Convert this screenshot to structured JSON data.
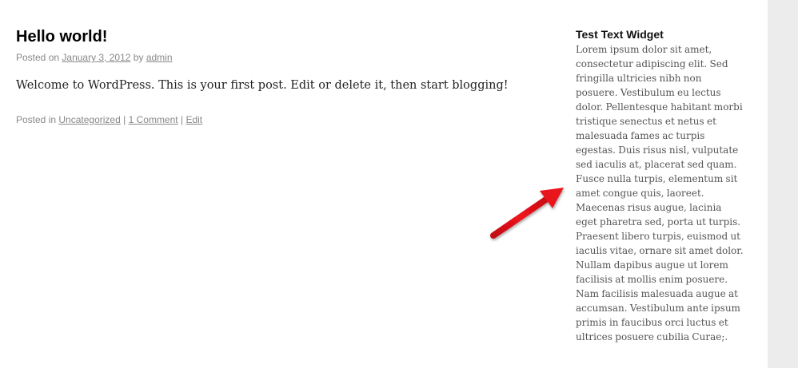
{
  "post": {
    "title": "Hello world!",
    "meta": {
      "posted_on": "Posted on",
      "date": "January 3, 2012",
      "by": "by",
      "author": "admin"
    },
    "content": "Welcome to WordPress. This is your first post. Edit or delete it, then start blogging!",
    "footer": {
      "posted_in": "Posted in",
      "category": "Uncategorized",
      "comments": "1 Comment",
      "edit": "Edit",
      "separator": "|"
    }
  },
  "widget": {
    "title": "Test Text Widget",
    "text": "Lorem ipsum dolor sit amet, consectetur adipiscing elit. Sed fringilla ultricies nibh non posuere. Vestibulum eu lectus dolor. Pellentesque habitant morbi tristique senectus et netus et malesuada fames ac turpis egestas. Duis risus nisl, vulputate sed iaculis at, placerat sed quam. Fusce nulla turpis, elementum sit amet congue quis, laoreet. Maecenas risus augue, lacinia eget pharetra sed, porta ut turpis. Praesent libero turpis, euismod ut iaculis vitae, ornare sit amet dolor. Nullam dapibus augue ut lorem facilisis at mollis enim posuere. Nam facilisis malesuada augue at accumsan. Vestibulum ante ipsum primis in faucibus orci luctus et ultrices posuere cubilia Curae;."
  },
  "annotation": {
    "arrow_icon": "red-arrow-icon",
    "arrow_color": "#e8141c"
  },
  "colors": {
    "page_background": "#ffffff",
    "gutter_background": "#ececec",
    "meta_text": "#888888",
    "widget_text": "#555555"
  }
}
